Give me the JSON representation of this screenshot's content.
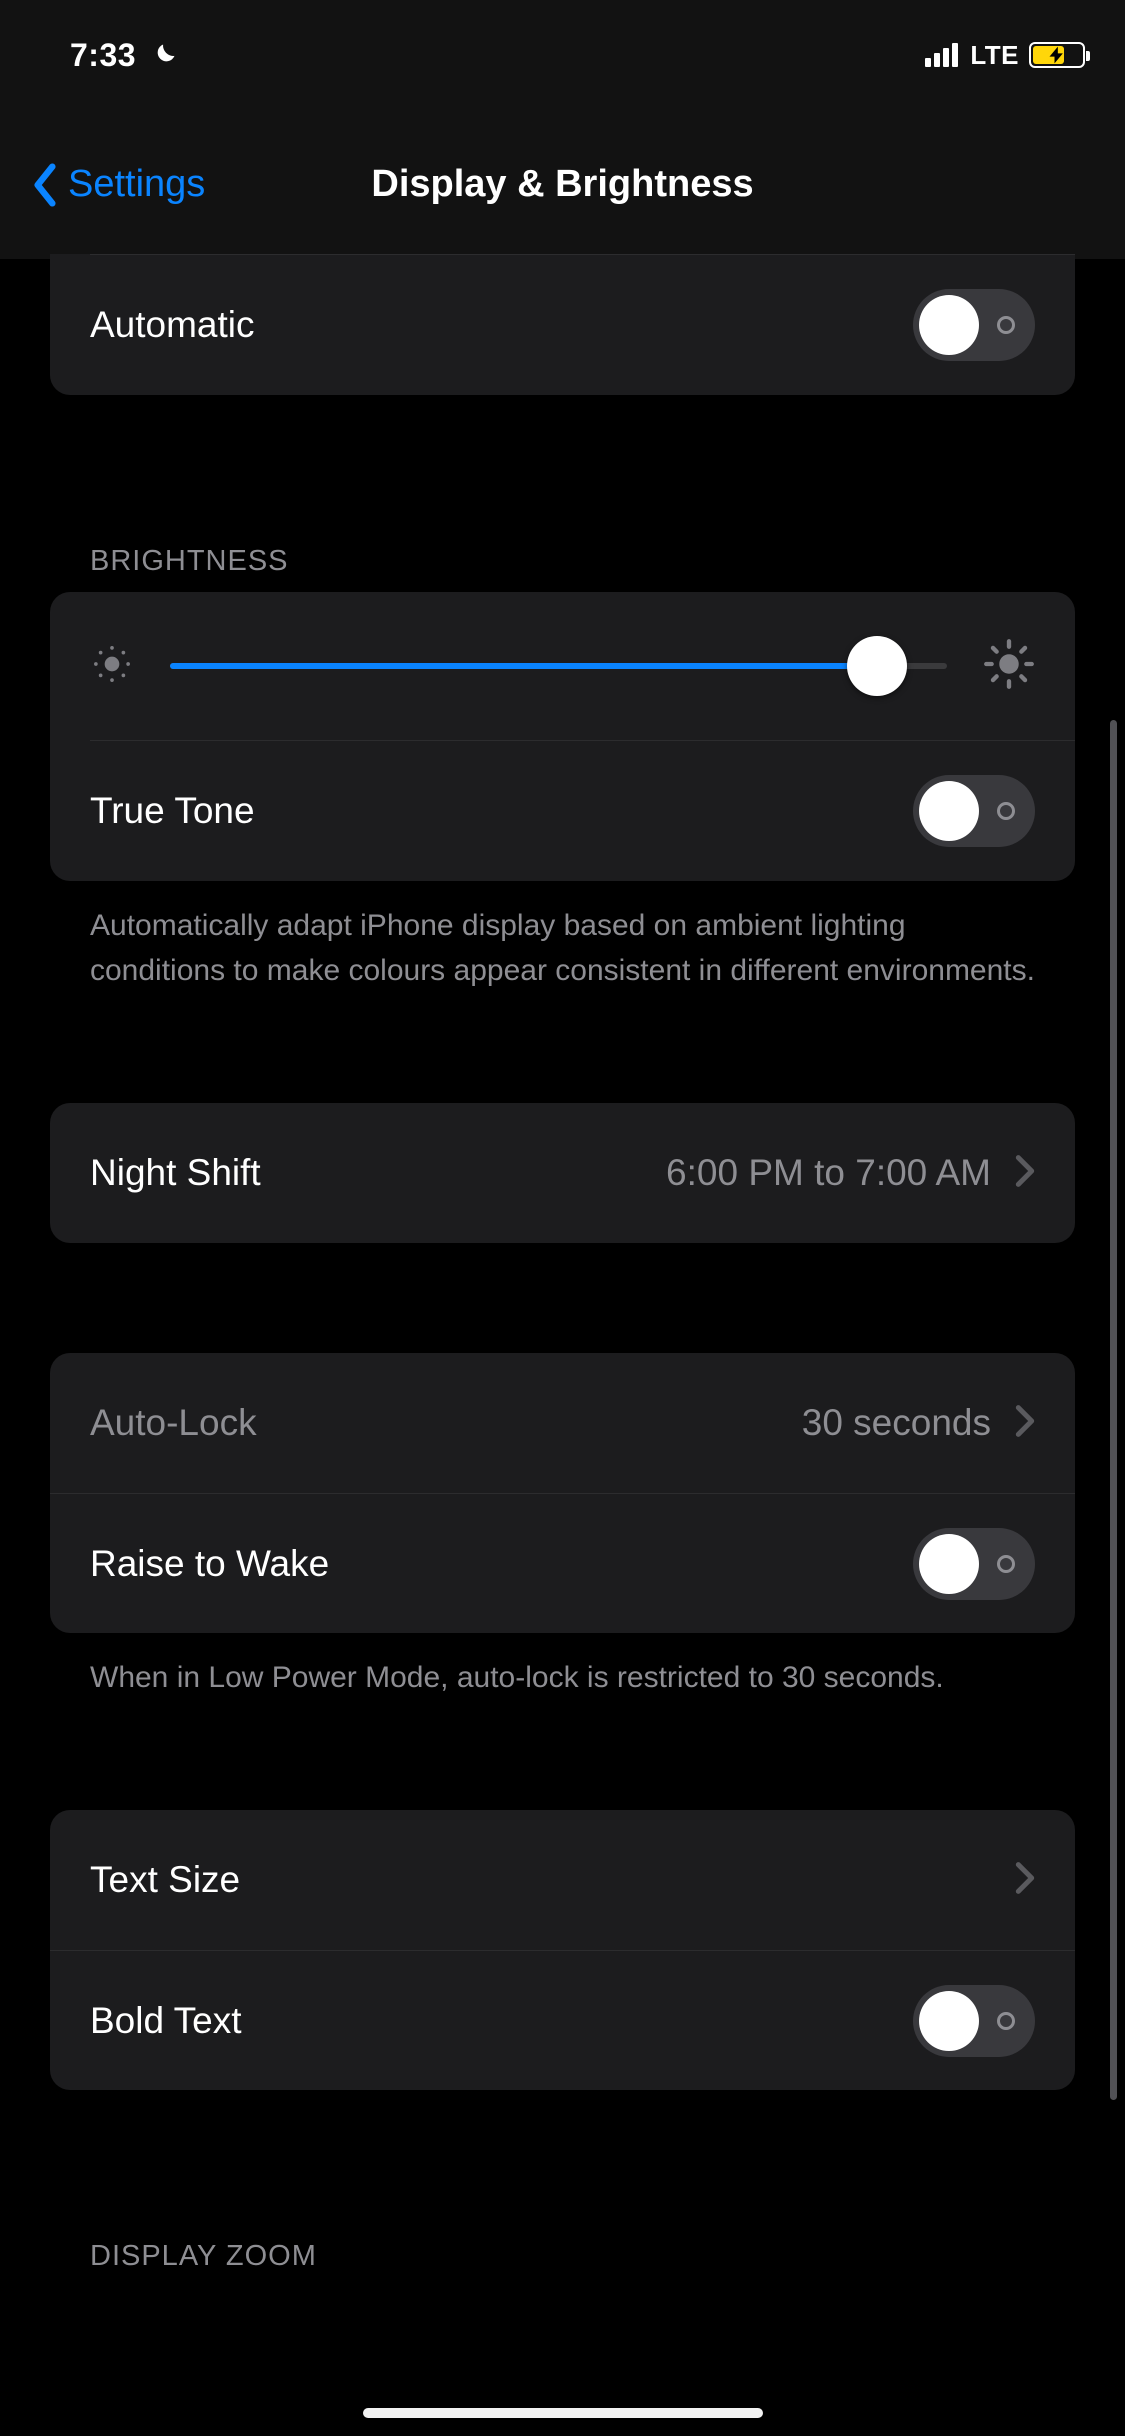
{
  "status": {
    "time": "7:33",
    "network": "LTE"
  },
  "nav": {
    "back_label": "Settings",
    "title": "Display & Brightness"
  },
  "appearance": {
    "automatic_label": "Automatic"
  },
  "brightness": {
    "header": "BRIGHTNESS",
    "value_pct": 91,
    "true_tone_label": "True Tone",
    "true_tone_footer": "Automatically adapt iPhone display based on ambient lighting conditions to make colours appear consistent in different environments."
  },
  "night_shift": {
    "label": "Night Shift",
    "value": "6:00 PM to 7:00 AM"
  },
  "lock": {
    "auto_lock_label": "Auto-Lock",
    "auto_lock_value": "30 seconds",
    "raise_to_wake_label": "Raise to Wake",
    "footer": "When in Low Power Mode, auto-lock is restricted to 30 seconds."
  },
  "text": {
    "text_size_label": "Text Size",
    "bold_text_label": "Bold Text"
  },
  "display_zoom": {
    "header": "DISPLAY ZOOM"
  }
}
